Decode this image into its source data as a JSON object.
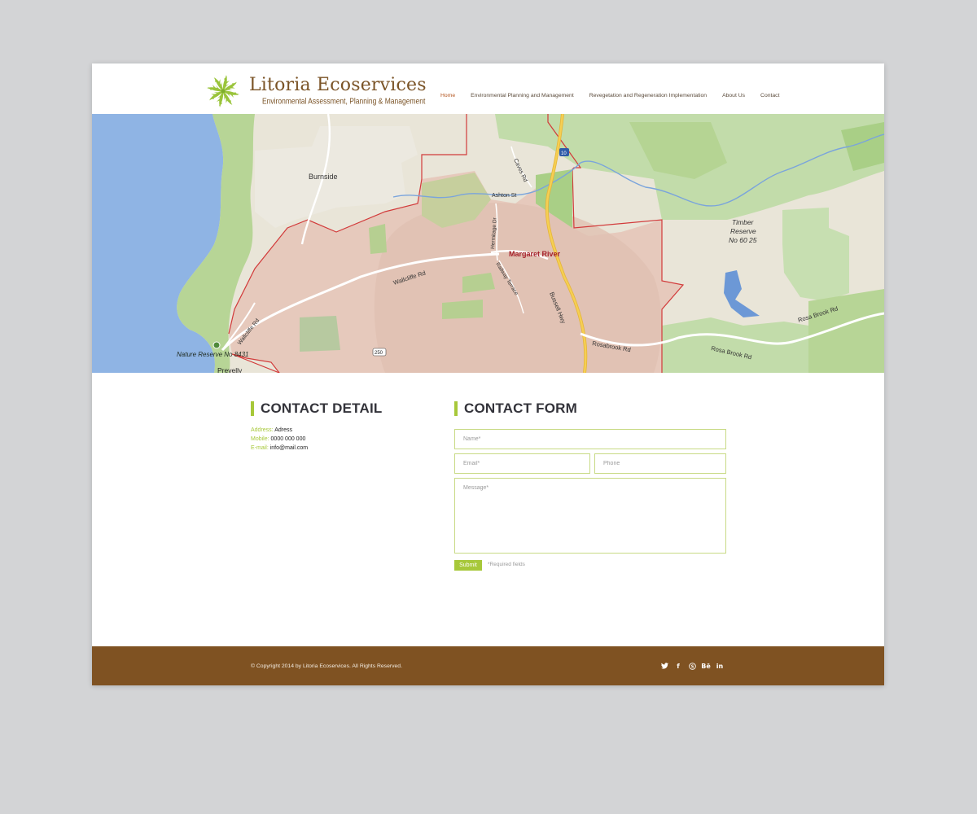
{
  "brand": {
    "name": "Litoria Ecoservices",
    "tagline": "Environmental  Assessment,  Planning  &  Management"
  },
  "nav": {
    "items": [
      {
        "label": "Home",
        "active": true
      },
      {
        "label": "Environmental Planning and Management"
      },
      {
        "label": "Revegetation and Regeneration Implementation"
      },
      {
        "label": "About Us"
      },
      {
        "label": "Contact"
      }
    ]
  },
  "map": {
    "labels": {
      "burnside": "Burnside",
      "ashton": "Ashton St",
      "caves": "Caves Rd",
      "hermitage": "Hermitage Dr",
      "margaret": "Margaret River",
      "railway": "Railway Terrace",
      "wallcliffe1": "Wallcliffe Rd",
      "wallcliffe2": "Wallcliffe Rd",
      "bussell": "Bussell Hwy",
      "rosabrook": "Rosabrook Rd",
      "rosabrook2": "Rosa Brook Rd",
      "rosabrook3": "Rosa Brook Rd",
      "timber1": "Timber",
      "timber2": "Reserve",
      "timber3": "No 60 25",
      "nature": "Nature Reserve No 8431",
      "prevelly": "Prevelly",
      "route10": "10",
      "route250": "250"
    }
  },
  "contact_detail": {
    "title": "CONTACT DETAIL",
    "address_label": "Address:",
    "address_value": "Adress",
    "mobile_label": "Mobile:",
    "mobile_value": "0000 000 000",
    "email_label": "E-mail:",
    "email_value": "info@mail.com"
  },
  "contact_form": {
    "title": "CONTACT FORM",
    "name_placeholder": "Name*",
    "email_placeholder": "Email*",
    "phone_placeholder": "Phone",
    "message_placeholder": "Message*",
    "submit_label": "Submit",
    "required_note": "*Required fields"
  },
  "footer": {
    "copyright": "© Copyright 2014 by Litoria Ecoservices. All Rights Reserved.",
    "social": [
      {
        "name": "twitter-icon",
        "glyph": "🐦"
      },
      {
        "name": "facebook-icon",
        "glyph": "f"
      },
      {
        "name": "skype-icon",
        "glyph": "S"
      },
      {
        "name": "behance-icon",
        "glyph": "Bē"
      },
      {
        "name": "linkedin-icon",
        "glyph": "in"
      }
    ]
  },
  "colors": {
    "accent": "#a7c83a",
    "brand_brown": "#7f5222",
    "nav_active": "#b3541e",
    "water": "#8fb4e4",
    "park": "#b9d89a",
    "town_zone": "#e6c9bc"
  }
}
